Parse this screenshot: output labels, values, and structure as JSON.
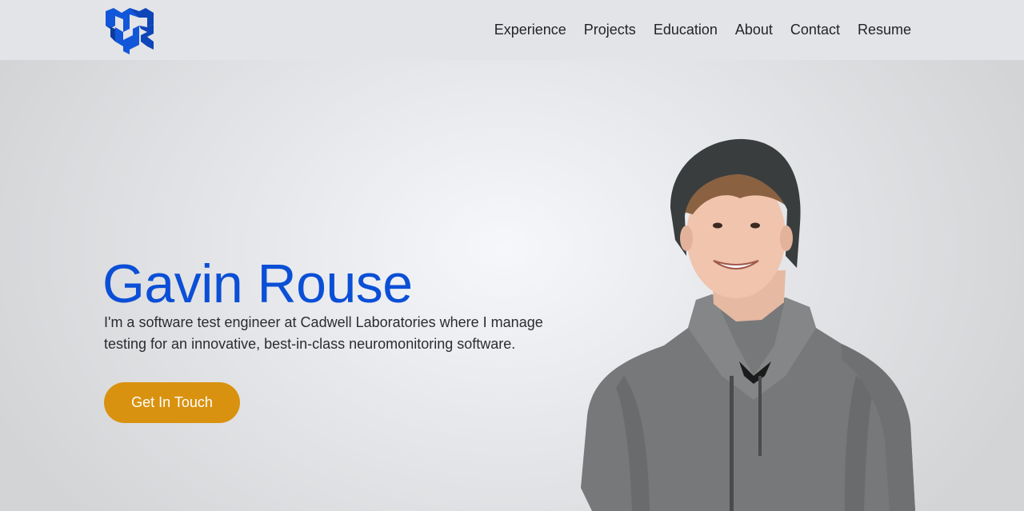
{
  "header": {
    "logo_icon": "gr-monogram-logo",
    "brand_color": "#1257d9",
    "nav": [
      {
        "label": "Experience"
      },
      {
        "label": "Projects"
      },
      {
        "label": "Education"
      },
      {
        "label": "About"
      },
      {
        "label": "Contact"
      },
      {
        "label": "Resume"
      }
    ]
  },
  "hero": {
    "name": "Gavin Rouse",
    "description": "I'm a software test engineer at Cadwell Laboratories where I manage testing for an innovative, best-in-class neuromonitoring software.",
    "cta_label": "Get In Touch",
    "name_color": "#0b4fd6",
    "cta_color": "#d9920f",
    "portrait_icon": "profile-photo"
  }
}
